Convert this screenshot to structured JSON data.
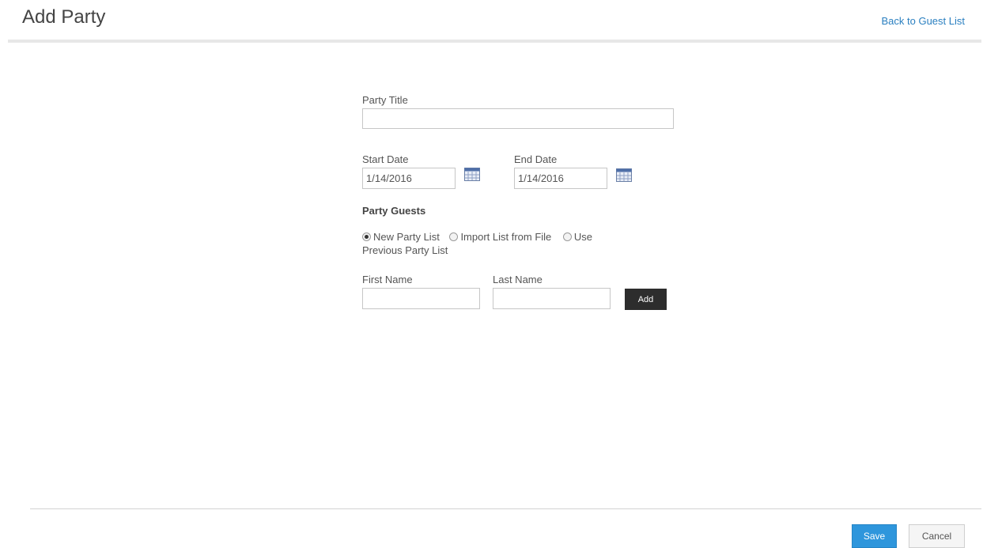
{
  "header": {
    "title": "Add Party",
    "back_link": "Back to Guest List"
  },
  "form": {
    "party_title_label": "Party Title",
    "party_title_value": "",
    "start_date_label": "Start Date",
    "start_date_value": "1/14/2016",
    "end_date_label": "End Date",
    "end_date_value": "1/14/2016",
    "calendar_icon": "calendar-icon",
    "guests_heading": "Party Guests",
    "guest_source_options": [
      {
        "label": "New Party List",
        "selected": true
      },
      {
        "label": "Import List from File",
        "selected": false
      },
      {
        "label": "Use",
        "selected": false
      }
    ],
    "guest_source_option_3_continued": "Previous Party List",
    "first_name_label": "First Name",
    "first_name_value": "",
    "last_name_label": "Last Name",
    "last_name_value": "",
    "add_button": "Add"
  },
  "footer": {
    "save_button": "Save",
    "cancel_button": "Cancel"
  },
  "colors": {
    "link": "#2a7fc0",
    "save_button": "#2e96dc",
    "add_button": "#2d2d2d"
  }
}
